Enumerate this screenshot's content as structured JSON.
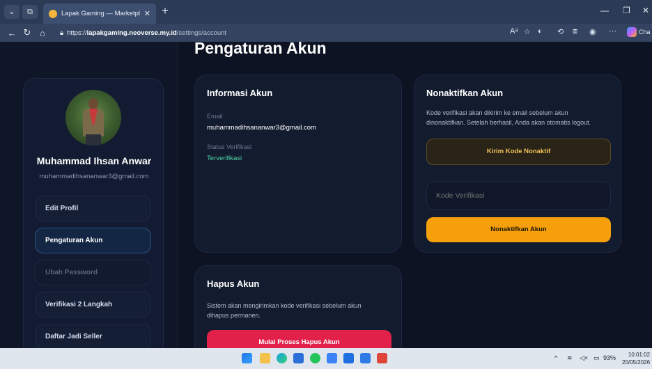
{
  "browser": {
    "tab_title": "Lapak Gaming — Marketplace Ga",
    "url_scheme": "https://",
    "url_host": "lapakgaming.neoverse.my.id",
    "url_path": "/settings/account",
    "copilot_label": "Cha"
  },
  "page": {
    "title": "Pengaturan Akun"
  },
  "profile": {
    "name": "Muhammad Ihsan Anwar",
    "email": "muhammadihsananwar3@gmail.com"
  },
  "sidebar": {
    "items": [
      {
        "label": "Edit Profil",
        "state": "normal"
      },
      {
        "label": "Pengaturan Akun",
        "state": "active"
      },
      {
        "label": "Ubah Password",
        "state": "disabled"
      },
      {
        "label": "Verifikasi 2 Langkah",
        "state": "normal"
      },
      {
        "label": "Daftar Jadi Seller",
        "state": "normal"
      }
    ]
  },
  "info_card": {
    "title": "Informasi Akun",
    "email_label": "Email",
    "email_value": "muhammadihsananwar3@gmail.com",
    "status_label": "Status Verifikasi",
    "status_value": "Terverifikasi"
  },
  "deactivate_card": {
    "title": "Nonaktifkan Akun",
    "desc_line1": "Kode verifikasi akan dikirim ke email sebelum akun",
    "desc_line2": "dinonaktifkan. Setelah berhasil, Anda akan otomatis logout.",
    "send_button": "Kirim Kode Nonaktif",
    "code_placeholder": "Kode Verifikasi",
    "submit_button": "Nonaktifkan Akun"
  },
  "delete_card": {
    "title": "Hapus Akun",
    "desc_line1": "Sistem akan mengirimkan kode verifikasi sebelum akun",
    "desc_line2": "dihapus permanen.",
    "button": "Mulai Proses Hapus Akun"
  },
  "taskbar": {
    "battery": "93%",
    "time": "10:01:02",
    "date": "20/05/2026"
  },
  "colors": {
    "accent_gold": "#f59f0b",
    "danger": "#e1214a",
    "verified": "#4fd7a4",
    "background": "#0d1322"
  }
}
